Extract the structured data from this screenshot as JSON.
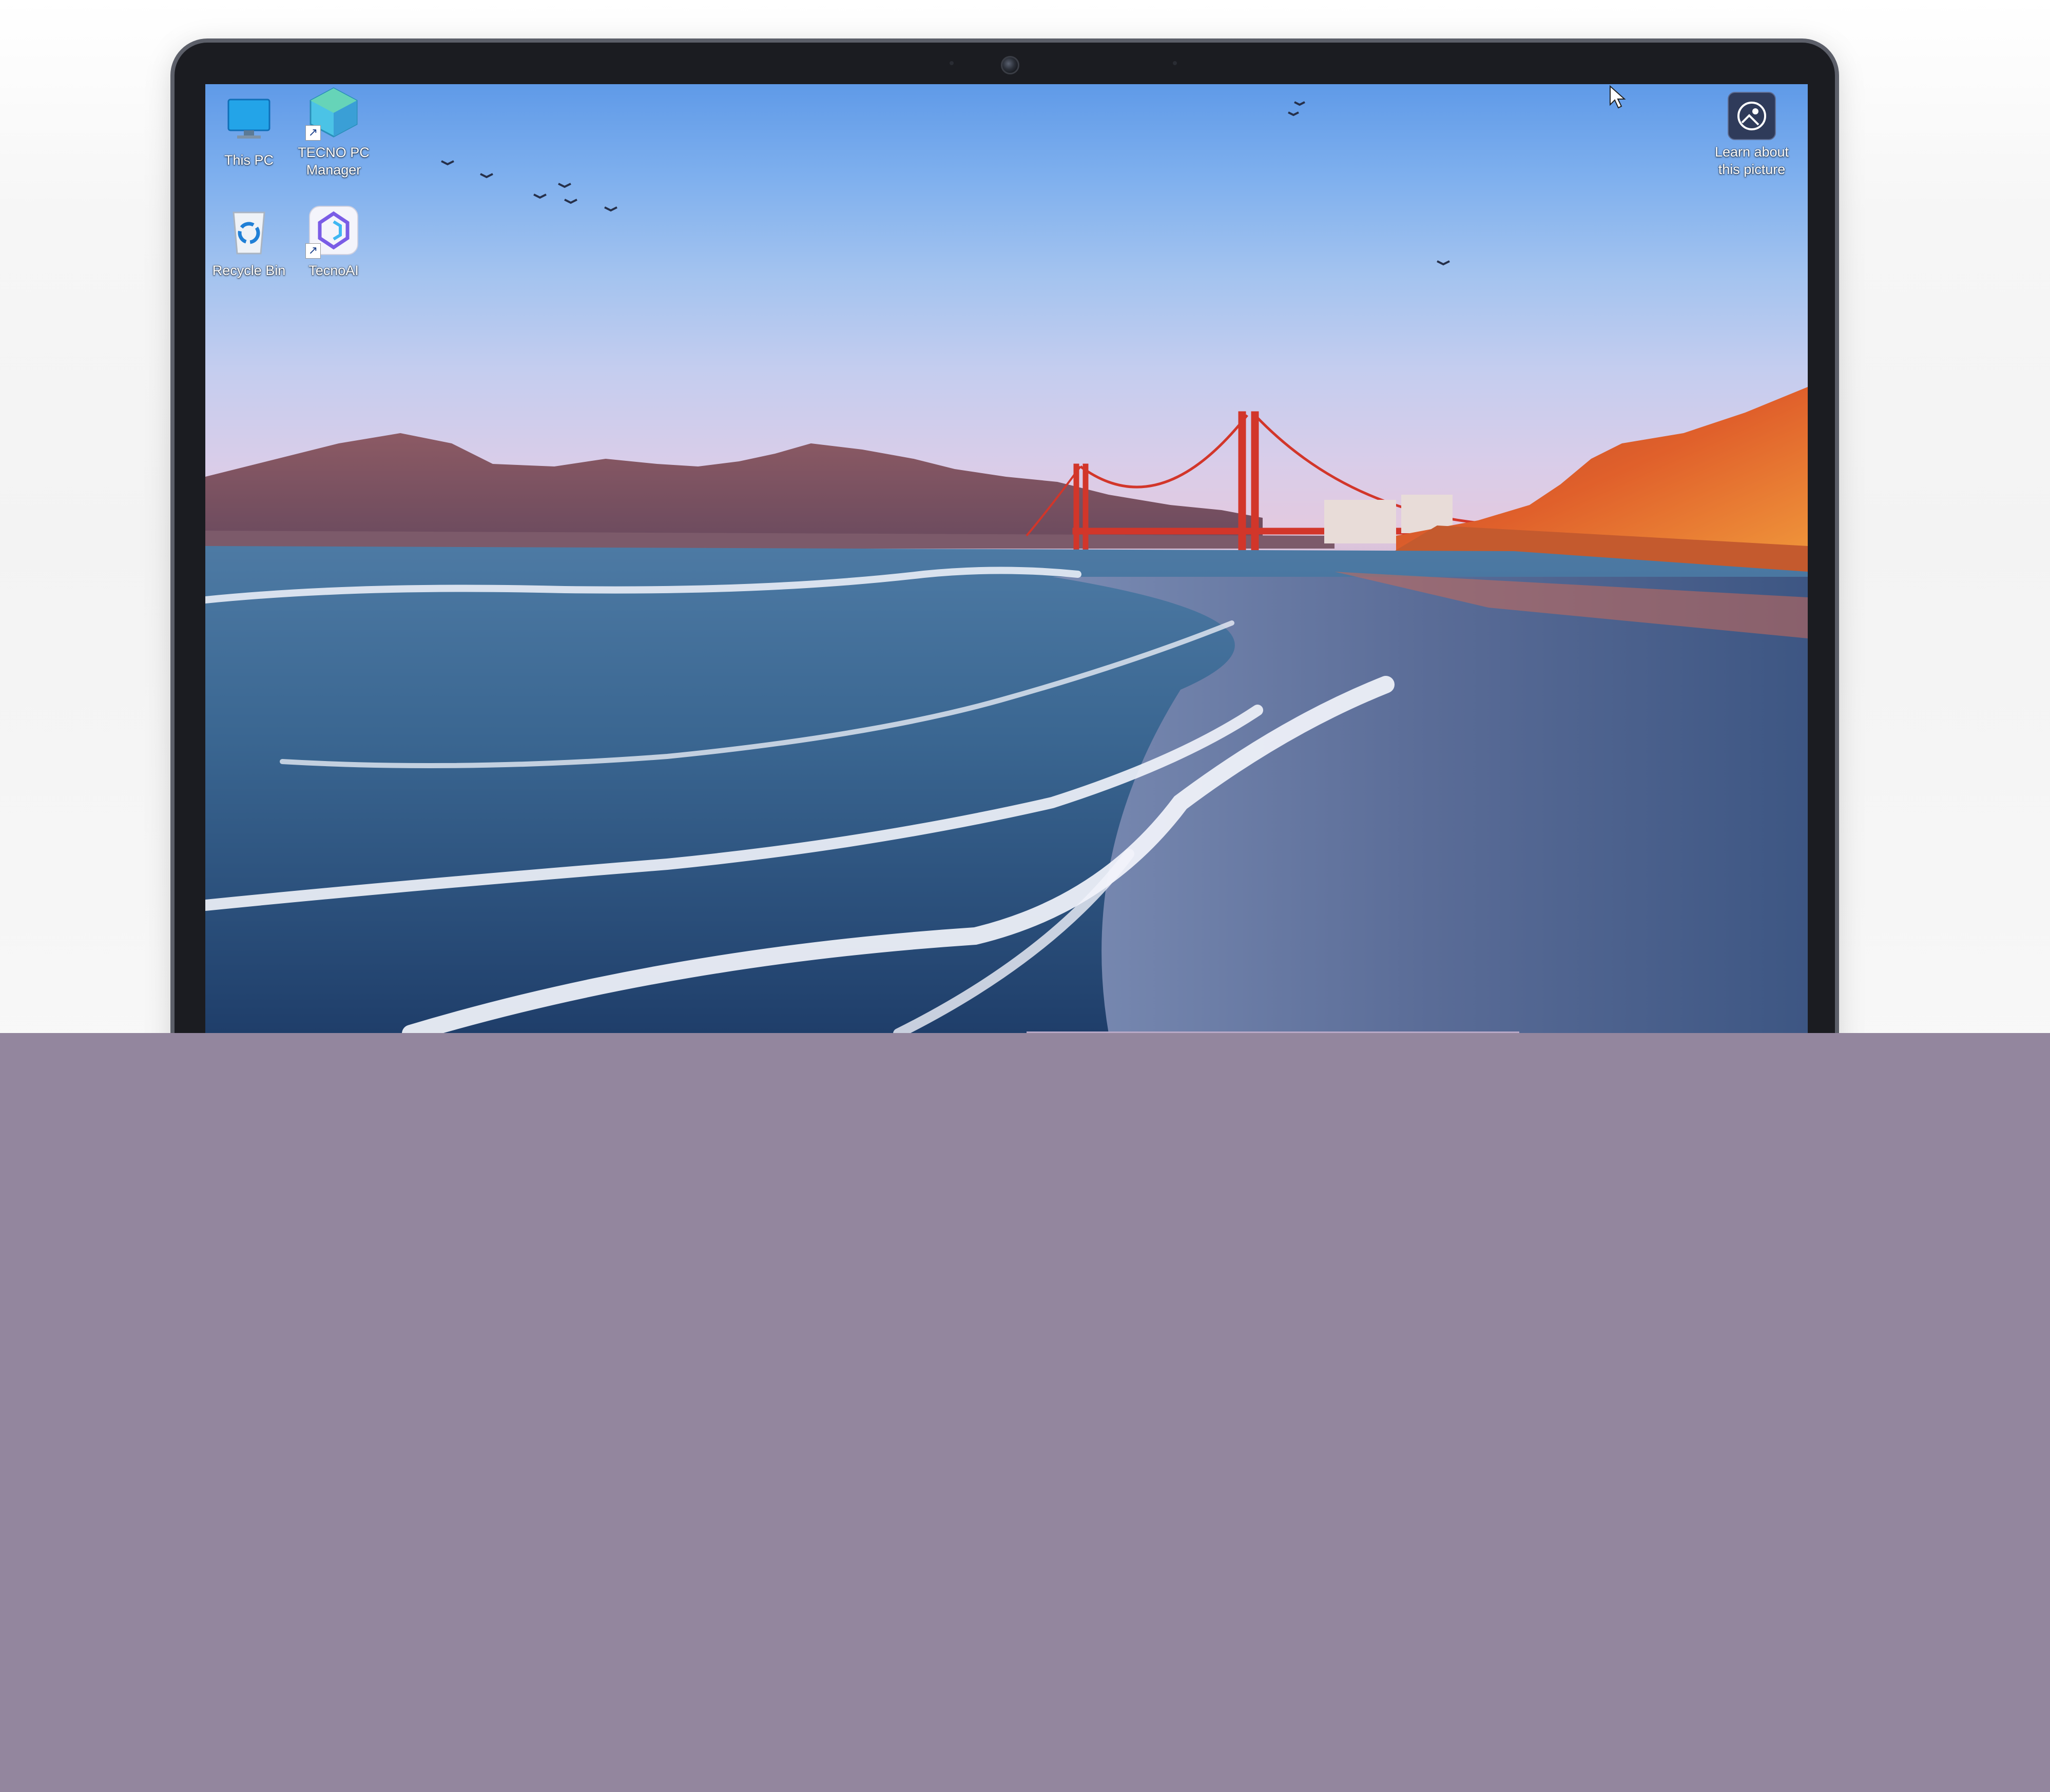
{
  "desktop": {
    "icons": [
      {
        "label": "This PC",
        "icon": "monitor-icon"
      },
      {
        "label": "TECNO PC Manager",
        "icon": "tecno-pc-manager-icon",
        "shortcut": true
      },
      {
        "label": "Recycle Bin",
        "icon": "recycle-bin-icon"
      },
      {
        "label": "TecnoAI",
        "icon": "tecnoai-icon",
        "shortcut": true
      }
    ],
    "spotlight": {
      "label": "Learn about this picture",
      "icon": "spotlight-camera-icon"
    }
  },
  "colors": {
    "lower_panel": "#93869e",
    "bezel": "#1b1c21",
    "sky_top": "#5f9ae8",
    "bridge": "#d2362a"
  },
  "icons": {
    "shortcut_arrow": "↗"
  }
}
